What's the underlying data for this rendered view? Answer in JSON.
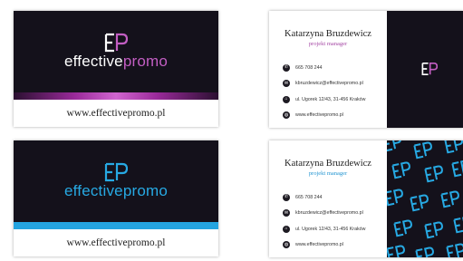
{
  "front": {
    "logo_first": "effective",
    "logo_second": "promo",
    "website": "www.effectivepromo.pl"
  },
  "back": {
    "name": "Katarzyna Bruzdewicz",
    "role": "projekt manager",
    "contact": {
      "phone": "665 708 244",
      "email": "kbruzdewicz@effectivepromo.pl",
      "address": "ul. Ugorek 12/43, 31-456 Kraków",
      "web": "www.effectivepromo.pl"
    }
  },
  "colors": {
    "dark": "#14111b",
    "pink": "#c35ec3",
    "blue": "#27a9e3"
  },
  "icons": [
    "phone-icon",
    "email-icon",
    "home-icon",
    "globe-icon"
  ]
}
